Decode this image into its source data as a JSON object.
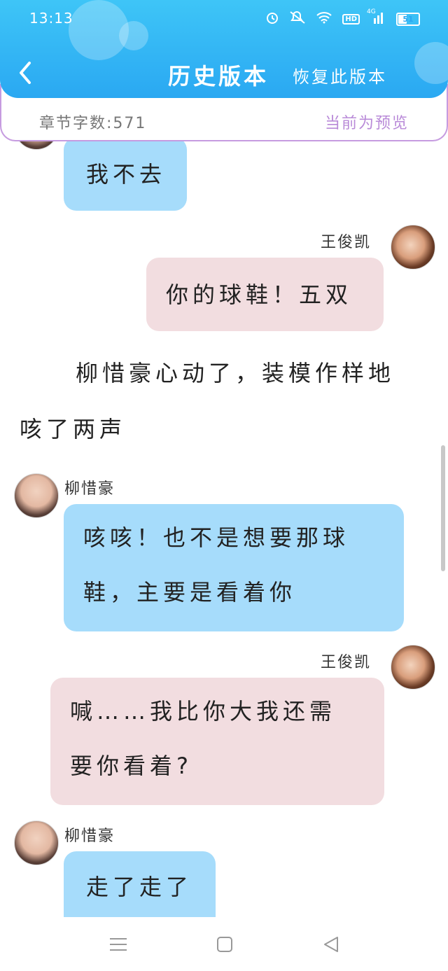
{
  "status_bar": {
    "time": "13:13",
    "battery": "51",
    "hd": "HD",
    "signal": "4G"
  },
  "header": {
    "title": "历史版本",
    "restore": "恢复此版本"
  },
  "info": {
    "word_count": "章节字数:571",
    "preview": "当前为预览"
  },
  "chat": {
    "msg0": "我不去",
    "wjk_name_1": "王俊凯",
    "msg1": "你的球鞋！五双",
    "narration_line1": "柳惜豪心动了，装模作样地",
    "narration_line2": "咳了两声",
    "lxh_name_1": "柳惜豪",
    "msg2_line1": "咳咳！也不是想要那球",
    "msg2_line2": "鞋，主要是看着你",
    "wjk_name_2": "王俊凯",
    "msg3_line1": "喊……我比你大我还需",
    "msg3_line2": "要你看着?",
    "lxh_name_2": "柳惜豪",
    "msg4": "走了走了"
  },
  "colors": {
    "header": "#2aa8f2",
    "blue_bubble": "#a6dcfb",
    "pink_bubble": "#f2dde0",
    "accent": "#b98ad8"
  }
}
